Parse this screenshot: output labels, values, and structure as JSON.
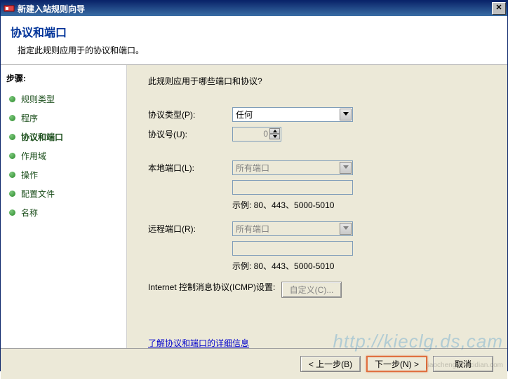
{
  "window": {
    "title": "新建入站规则向导",
    "close_glyph": "✕"
  },
  "header": {
    "title": "协议和端口",
    "subtitle": "指定此规则应用于的协议和端口。"
  },
  "sidebar": {
    "steps_label": "步骤:",
    "items": [
      {
        "label": "规则类型"
      },
      {
        "label": "程序"
      },
      {
        "label": "协议和端口"
      },
      {
        "label": "作用域"
      },
      {
        "label": "操作"
      },
      {
        "label": "配置文件"
      },
      {
        "label": "名称"
      }
    ]
  },
  "content": {
    "question": "此规则应用于哪些端口和协议?",
    "protocol_type_label": "协议类型(P):",
    "protocol_type_value": "任何",
    "protocol_number_label": "协议号(U):",
    "protocol_number_value": "0",
    "local_port_label": "本地端口(L):",
    "local_port_value": "所有端口",
    "local_port_hint": "示例: 80、443、5000-5010",
    "remote_port_label": "远程端口(R):",
    "remote_port_value": "所有端口",
    "remote_port_hint": "示例: 80、443、5000-5010",
    "icmp_label": "Internet 控制消息协议(ICMP)设置:",
    "icmp_button": "自定义(C)...",
    "learn_more": "了解协议和端口的详细信息"
  },
  "footer": {
    "back": "< 上一步(B)",
    "next": "下一步(N) >",
    "cancel": "取消"
  },
  "watermark": "http://kieclg.ds,cam",
  "watermark2": "jiaocheng.chazidian.com"
}
